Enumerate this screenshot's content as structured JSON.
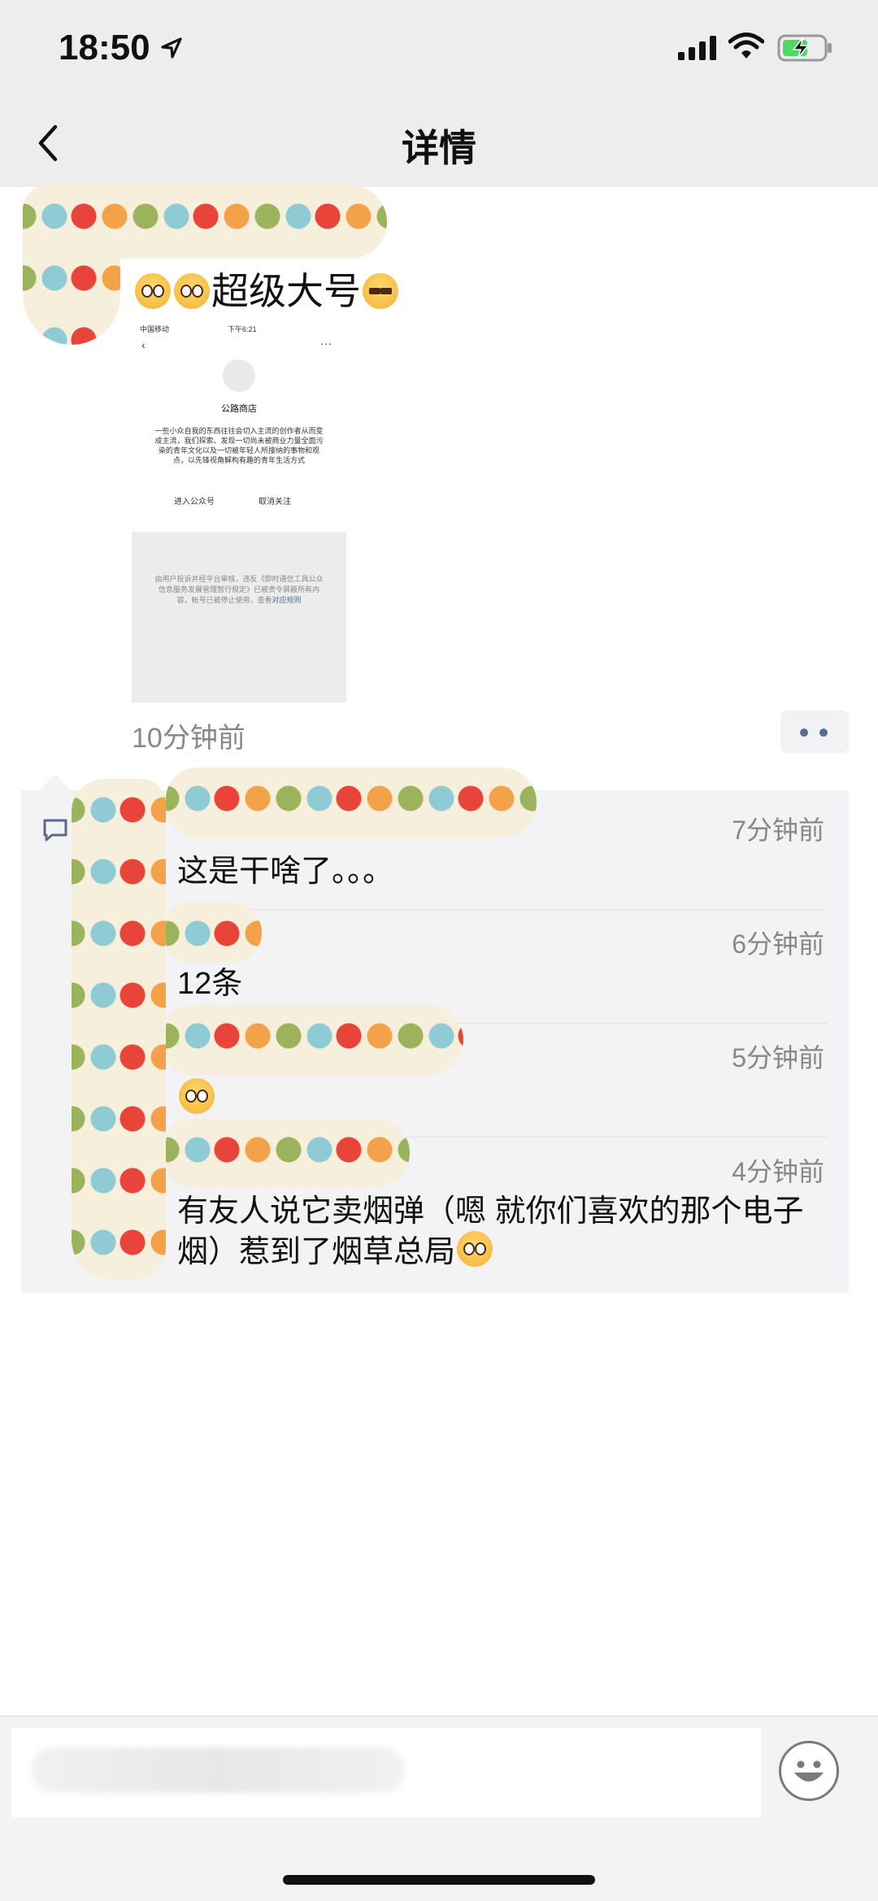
{
  "status_bar": {
    "time": "18:50"
  },
  "nav": {
    "title": "详情",
    "back_icon": "chevron-left-icon"
  },
  "post": {
    "text": "超级大号",
    "shared_card": {
      "carrier": "中国移动",
      "time": "下午6:21",
      "account_name": "公路商店",
      "description": "一些小众自我的东西往往会切入主流的创作者从而变成主流，我们探索、发现一切尚未被商业力量全面污染的青年文化以及一切被年轻人所接纳的事物和观点，以先锋视角解构有趣的青年生活方式",
      "button_enter": "进入公众号",
      "button_unfollow": "取消关注"
    },
    "blocked_notice": {
      "text": "由用户投诉并经平台审核，违反《即时通信工具公众信息服务发展管理暂行规定》已被责令屏蔽所有内容，帐号已被停止使用，查看",
      "link": "对应规则"
    },
    "time": "10分钟前"
  },
  "comments": [
    {
      "time": "7分钟前",
      "text": "这是干啥了。。。"
    },
    {
      "time": "6分钟前",
      "text": "12条"
    },
    {
      "time": "5分钟前",
      "text": ""
    },
    {
      "time": "4分钟前",
      "text": "有友人说它卖烟弹（嗯 就你们喜欢的那个电子烟）惹到了烟草总局"
    }
  ],
  "icons": [
    "location-arrow-icon",
    "signal-icon",
    "wifi-icon",
    "battery-charging-icon",
    "comment-icon",
    "emoji-button-icon",
    "more-dots-icon"
  ],
  "colors": {
    "bar_bg": "#ededed",
    "comment_bg": "#f3f3f5",
    "link": "#4d6a9a",
    "battery_green": "#4cd964"
  }
}
